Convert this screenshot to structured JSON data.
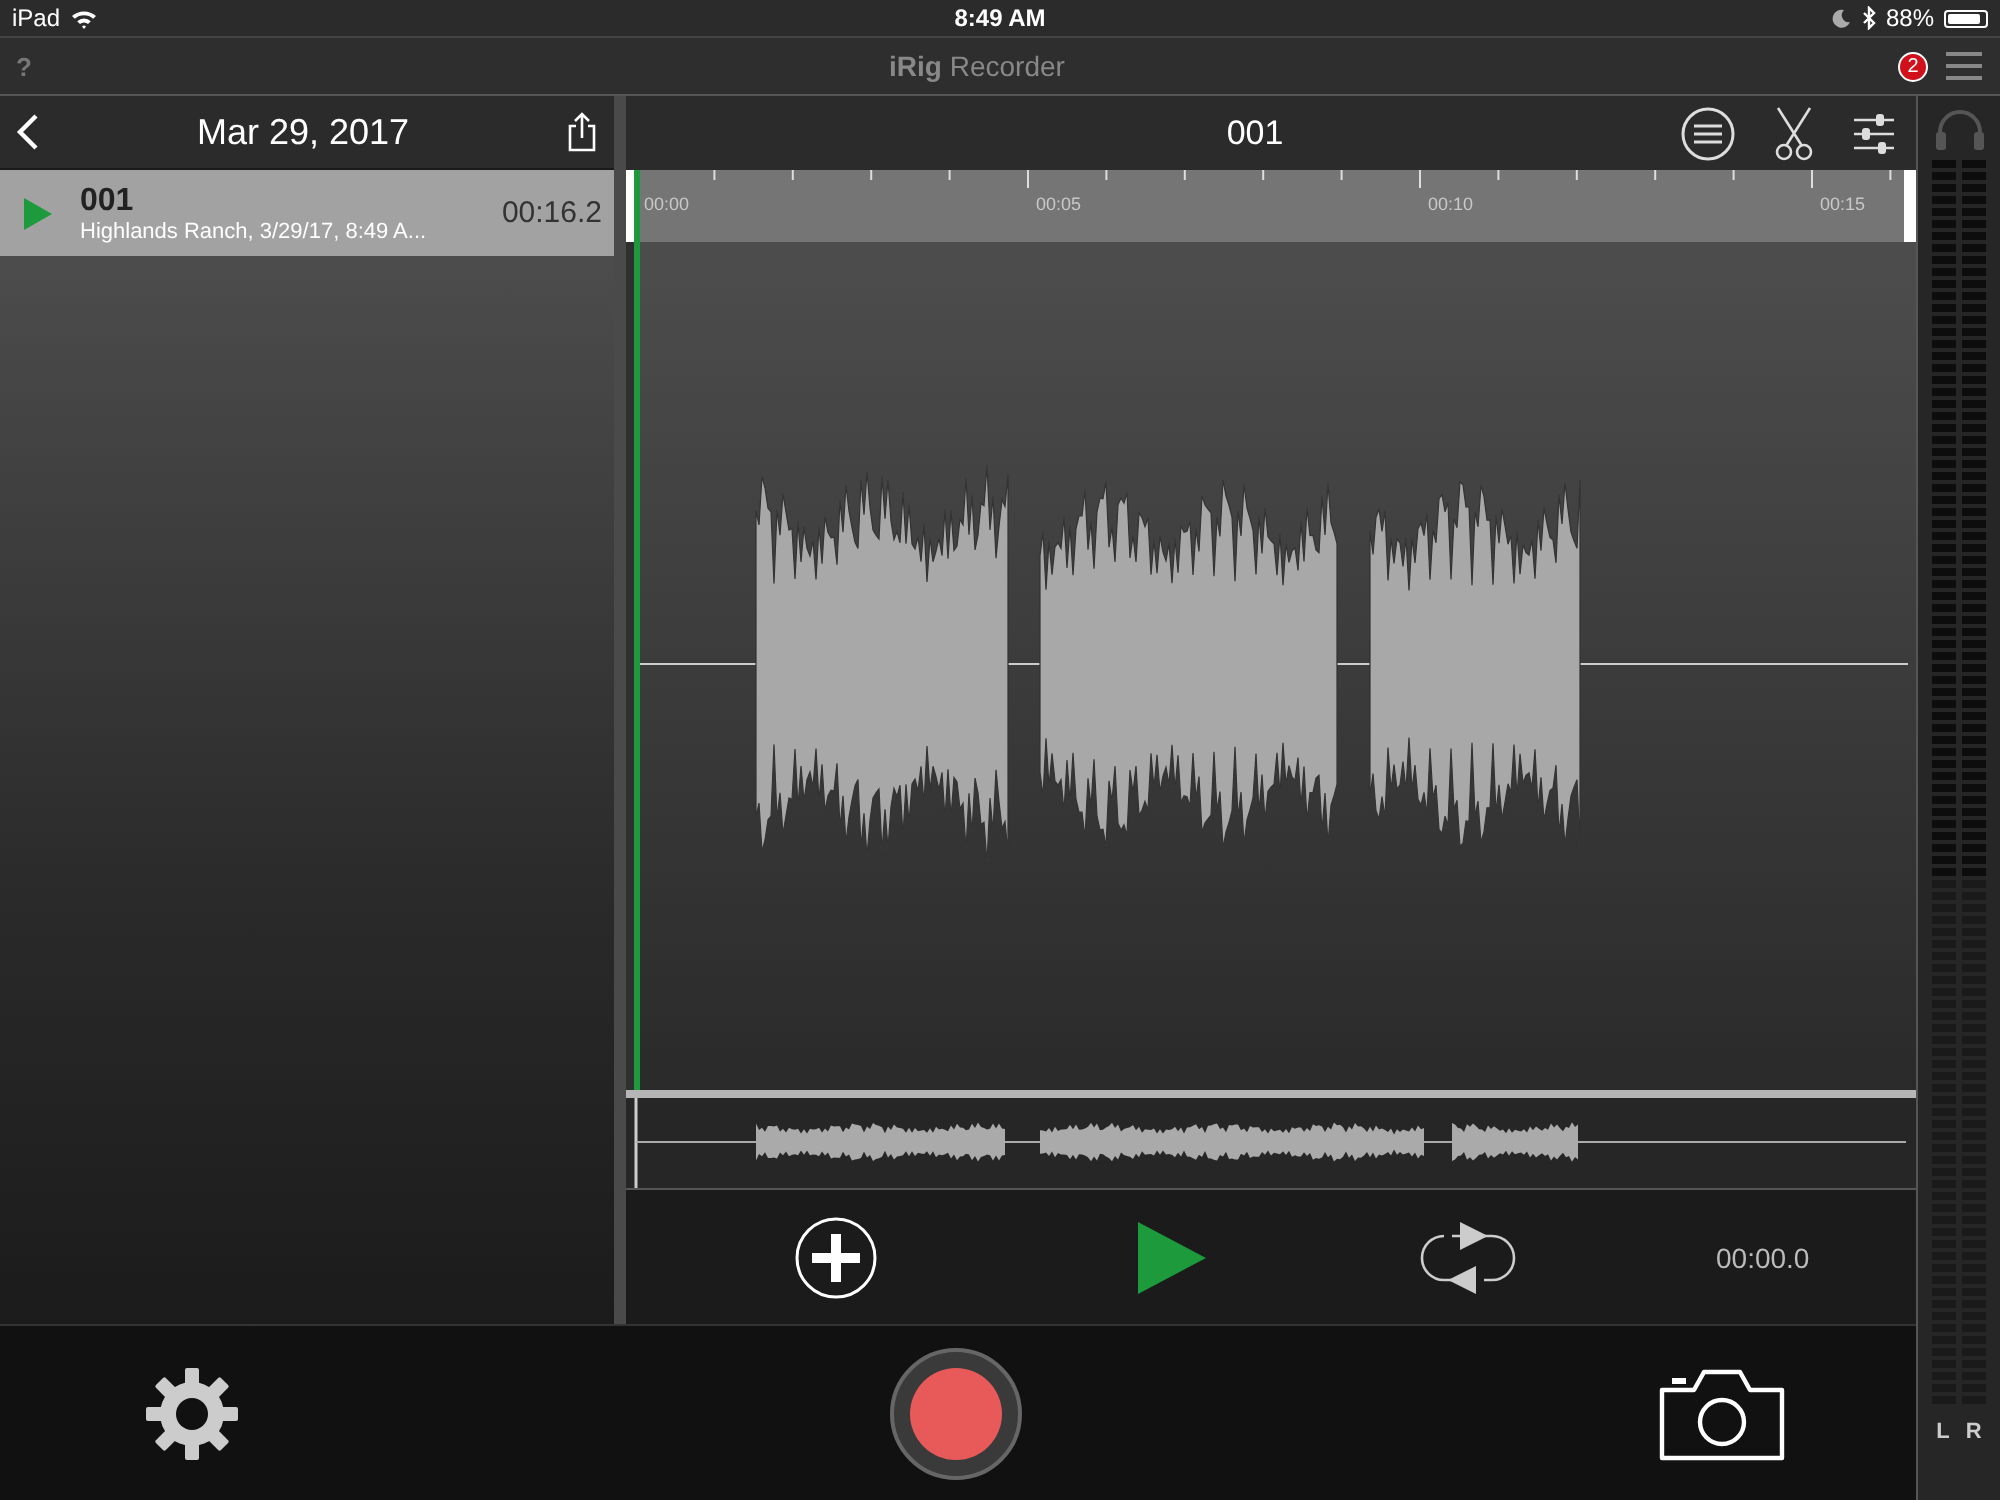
{
  "status_bar": {
    "device": "iPad",
    "time": "8:49 AM",
    "battery": "88%"
  },
  "app_bar": {
    "help": "?",
    "title": "**iRig** Recorder",
    "badge": "2"
  },
  "recordings_panel": {
    "date": "Mar 29, 2017",
    "items": [
      {
        "name": "001",
        "subtitle": "Highlands Ranch, 3/29/17, 8:49 A...",
        "duration": "00:16.2",
        "selected": true
      }
    ]
  },
  "editor": {
    "title": "001",
    "timeline": {
      "labels": [
        "00:00",
        "00:05",
        "00:10",
        "00:15"
      ]
    },
    "time": "00:00.0"
  },
  "meter": {
    "channels": [
      "L",
      "R"
    ]
  }
}
